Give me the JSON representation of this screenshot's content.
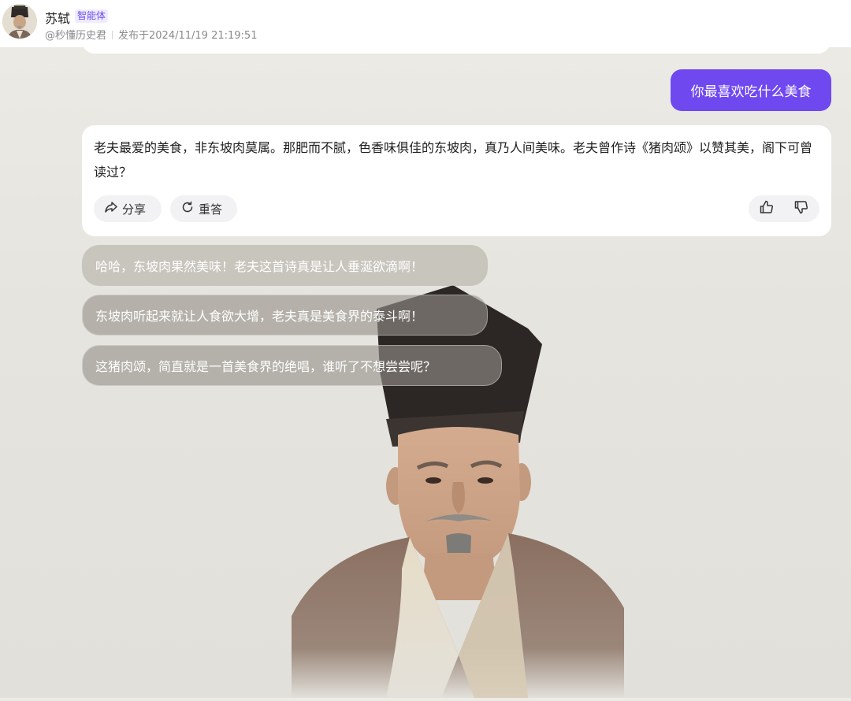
{
  "header": {
    "name": "苏轼",
    "badge": "智能体",
    "handle": "@秒懂历史君",
    "published": "发布于2024/11/19 21:19:51"
  },
  "chat": {
    "user_message": "你最喜欢吃什么美食",
    "ai_message": "老夫最爱的美食，非东坡肉莫属。那肥而不腻，色香味俱佳的东坡肉，真乃人间美味。老夫曾作诗《猪肉颂》以赞其美，阁下可曾读过？",
    "actions": {
      "share_label": "分享",
      "regenerate_label": "重答"
    }
  },
  "suggestions": [
    "哈哈，东坡肉果然美味！老夫这首诗真是让人垂涎欲滴啊！",
    "东坡肉听起来就让人食欲大增，老夫真是美食界的泰斗啊！",
    "这猪肉颂，简直就是一首美食界的绝唱，谁听了不想尝尝呢？"
  ],
  "colors": {
    "accent": "#7048f0",
    "badge_text": "#6c4cf0",
    "background": "#e8e6e0"
  },
  "icons": {
    "share": "share-icon",
    "regenerate": "refresh-icon",
    "like": "thumbs-up-icon",
    "dislike": "thumbs-down-icon"
  }
}
